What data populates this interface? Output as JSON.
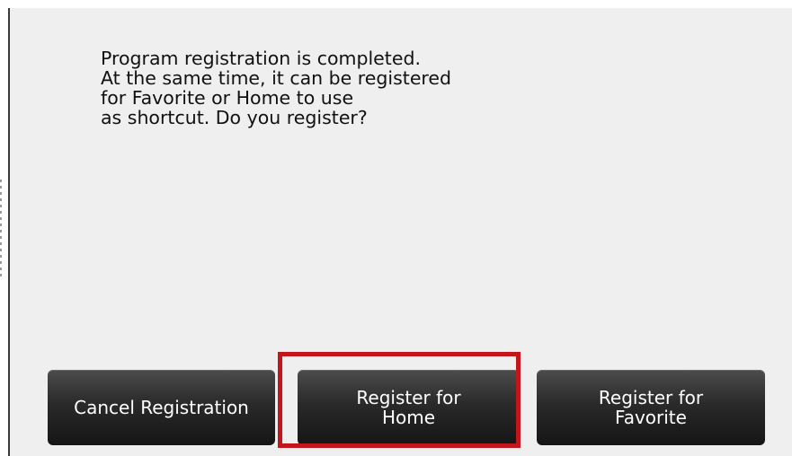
{
  "dialog": {
    "message": "Program registration is completed.\nAt the same time, it can be registered\nfor Favorite or Home to use\nas shortcut. Do you register?"
  },
  "buttons": {
    "cancel_label": "Cancel Registration",
    "home_label": "Register for\nHome",
    "favorite_label": "Register for\nFavorite"
  },
  "colors": {
    "highlight": "#c4151c",
    "button_bg": "#2a2a2a",
    "panel_bg": "#efefef"
  }
}
